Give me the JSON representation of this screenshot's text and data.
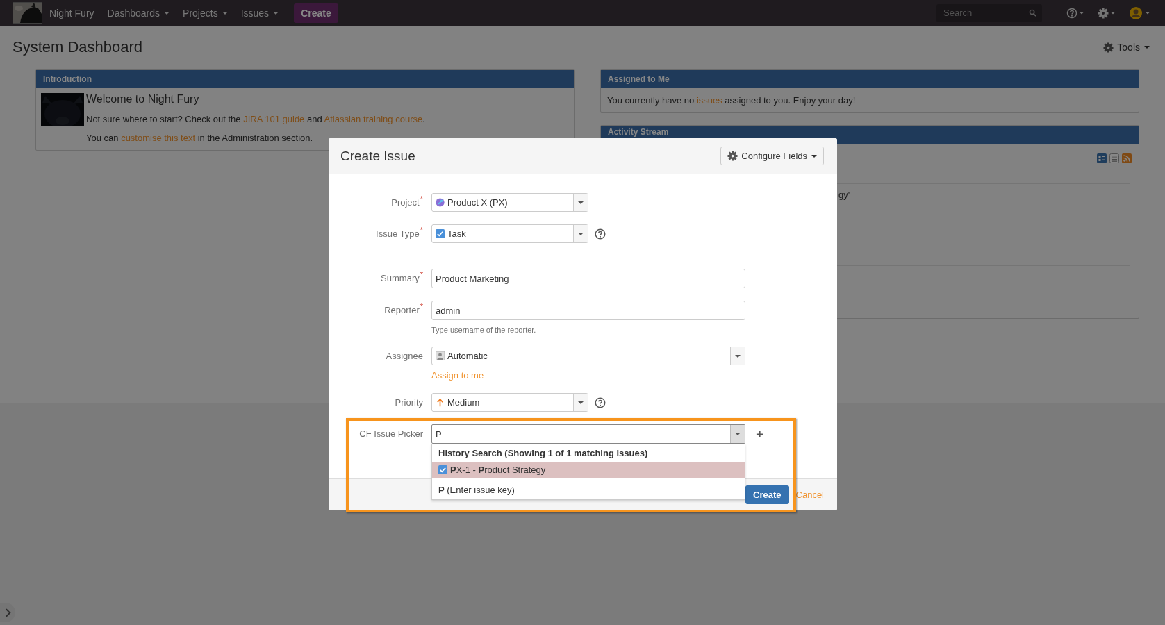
{
  "topbar": {
    "site_name": "Night Fury",
    "menus": [
      {
        "label": "Dashboards"
      },
      {
        "label": "Projects"
      },
      {
        "label": "Issues"
      }
    ],
    "create": "Create",
    "search": {
      "placeholder": "Search"
    }
  },
  "page": {
    "title": "System Dashboard",
    "tools": "Tools"
  },
  "introduction": {
    "title": "Introduction",
    "heading": "Welcome to Night Fury",
    "lines": [
      [
        {
          "kind": "text",
          "text": "Not sure where to start? Check out the "
        },
        {
          "kind": "link",
          "text": "JIRA 101 guide"
        },
        {
          "kind": "text",
          "text": " and "
        },
        {
          "kind": "link",
          "text": "Atlassian training course"
        },
        {
          "kind": "text",
          "text": "."
        }
      ],
      [
        {
          "kind": "text",
          "text": "You can "
        },
        {
          "kind": "link",
          "text": "customise this text"
        },
        {
          "kind": "text",
          "text": " in the Administration section."
        }
      ]
    ]
  },
  "assigned": {
    "title": "Assigned to Me",
    "line": [
      {
        "kind": "text",
        "text": "You currently have no "
      },
      {
        "kind": "link",
        "text": "issues"
      },
      {
        "kind": "text",
        "text": " assigned to you. Enjoy your day!"
      }
    ]
  },
  "activity": {
    "title": "Activity Stream",
    "fragment": "gy'"
  },
  "dialog": {
    "title": "Create Issue",
    "configure": "Configure Fields",
    "top_fields": [
      {
        "kind": "project",
        "label": "Project",
        "required_mark": "*",
        "value": "Product X (PX)",
        "help": false,
        "wide": false
      },
      {
        "kind": "issuetype",
        "label": "Issue Type",
        "required_mark": "*",
        "value": "Task",
        "help": true,
        "wide": false
      }
    ],
    "fields": [
      {
        "kind": "text",
        "label": "Summary",
        "required_mark": "*",
        "value": "Product Marketing"
      },
      {
        "kind": "text",
        "label": "Reporter",
        "required_mark": "*",
        "value": "admin",
        "hint": "Type username of the reporter."
      },
      {
        "kind": "assignee",
        "label": "Assignee",
        "value": "Automatic",
        "help": false,
        "wide": true,
        "link": "Assign to me"
      },
      {
        "kind": "priority",
        "label": "Priority",
        "value": "Medium",
        "help": true,
        "wide": false
      },
      {
        "kind": "picker",
        "label": "CF Issue Picker",
        "value": "P",
        "suggestions": {
          "header": "History Search (Showing 1 of 1 matching issues)",
          "items": [
            {
              "kind": "issue",
              "text": "**P**X-1 - **P**roduct Strategy",
              "selected": true
            },
            {
              "kind": "key",
              "text": "**P** (Enter issue key)",
              "selected": false
            }
          ]
        }
      }
    ],
    "create": "Create",
    "cancel": "Cancel"
  }
}
